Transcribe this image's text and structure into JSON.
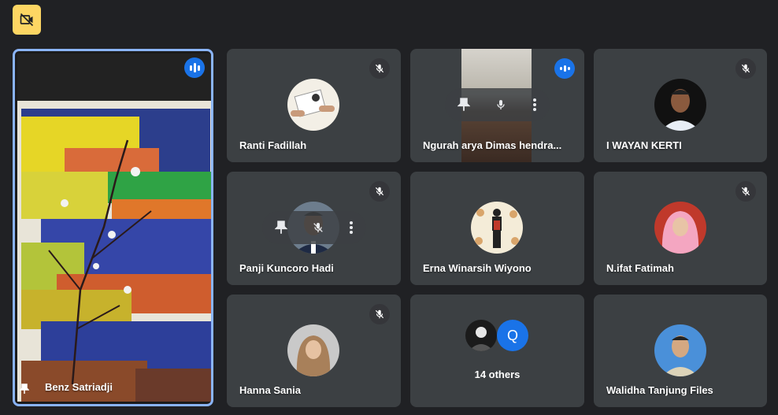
{
  "toolbar": {
    "camera_off_icon": "video-off-icon",
    "accent": "#fdd663"
  },
  "colors": {
    "tile": "#3c4043",
    "speaking": "#1a73e8",
    "background": "#202124",
    "pinned_border": "#8ab4f8"
  },
  "participants": [
    {
      "name": "Benz Satriadji",
      "status": "speaking",
      "pinned": true
    },
    {
      "name": "Ranti Fadillah",
      "status": "muted"
    },
    {
      "name": "Ngurah arya Dimas hendra...",
      "status": "speaking"
    },
    {
      "name": "I WAYAN KERTI",
      "status": "muted"
    },
    {
      "name": "Panji Kuncoro Hadi",
      "status": "muted"
    },
    {
      "name": "Erna Winarsih Wiyono",
      "status": "active"
    },
    {
      "name": "N.ifat Fatimah",
      "status": "muted"
    },
    {
      "name": "Hanna Sania",
      "status": "muted"
    },
    {
      "name": "Walidha Tanjung Files",
      "status": "active"
    }
  ],
  "others": {
    "label": "14 others",
    "avatar_letter": "Q"
  }
}
